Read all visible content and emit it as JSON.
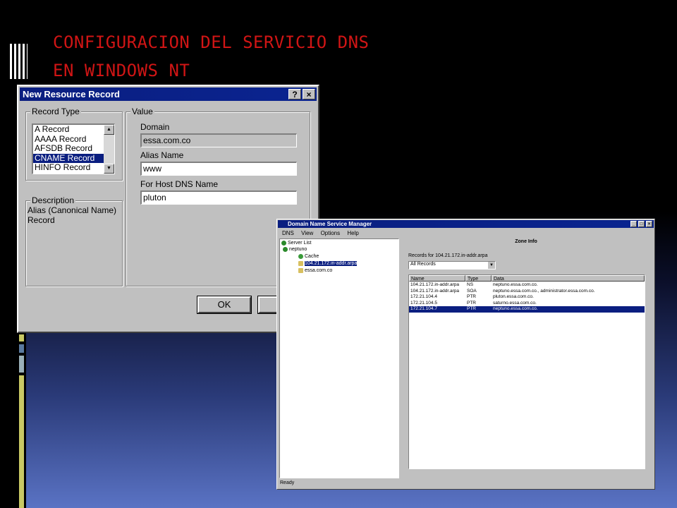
{
  "slide": {
    "title_line1": "CONFIGURACION DEL SERVICIO DNS",
    "title_line2": "EN WINDOWS NT",
    "colors": {
      "title": "#d01515",
      "accent_bars": [
        "#c8c864",
        "#5a7aa0",
        "#9ab0b8",
        "#c8c864"
      ]
    }
  },
  "dialog": {
    "title": "New Resource Record",
    "help_btn": "?",
    "close_btn": "×",
    "record_type_label": "Record Type",
    "record_types": [
      {
        "label": "A Record",
        "selected": false
      },
      {
        "label": "AAAA Record",
        "selected": false
      },
      {
        "label": "AFSDB Record",
        "selected": false
      },
      {
        "label": "CNAME Record",
        "selected": true
      },
      {
        "label": "HINFO Record",
        "selected": false
      }
    ],
    "value_label": "Value",
    "domain_label": "Domain",
    "domain_value": "essa.com.co",
    "alias_label": "Alias Name",
    "alias_value": "www",
    "host_label": "For Host DNS Name",
    "host_value": "pluton",
    "description_label": "Description",
    "description_text_line1": "Alias (Canonical Name)",
    "description_text_line2": "Record",
    "ok_button": "OK",
    "cancel_button": "C"
  },
  "dns_manager": {
    "title": "Domain Name Service Manager",
    "menu": [
      "DNS",
      "View",
      "Options",
      "Help"
    ],
    "tree": {
      "server_list": "Server List",
      "server": "neptuno",
      "cache": "Cache",
      "reverse_zone": "104.21.172.in-addr.arpa",
      "zone": "essa.com.co"
    },
    "zone_info_title": "Zone Info",
    "records_for_label": "Records for 104.21.172.in-addr.arpa",
    "filter_value": "All Records",
    "columns": [
      "Name",
      "Type",
      "Data"
    ],
    "rows": [
      {
        "name": "104.21.172.in-addr.arpa",
        "type": "NS",
        "data": "neptuno.essa.com.co.",
        "selected": false
      },
      {
        "name": "104.21.172.in-addr.arpa",
        "type": "SOA",
        "data": "neptuno.essa.com.co., administrator.essa.com.co.",
        "selected": false
      },
      {
        "name": "172.21.104.4",
        "type": "PTR",
        "data": "pluton.essa.com.co.",
        "selected": false
      },
      {
        "name": "172.21.104.5",
        "type": "PTR",
        "data": "saturno.essa.com.co.",
        "selected": false
      },
      {
        "name": "172.21.104.7",
        "type": "PTR",
        "data": "neptuno.essa.com.co.",
        "selected": true
      }
    ],
    "status": "Ready"
  }
}
